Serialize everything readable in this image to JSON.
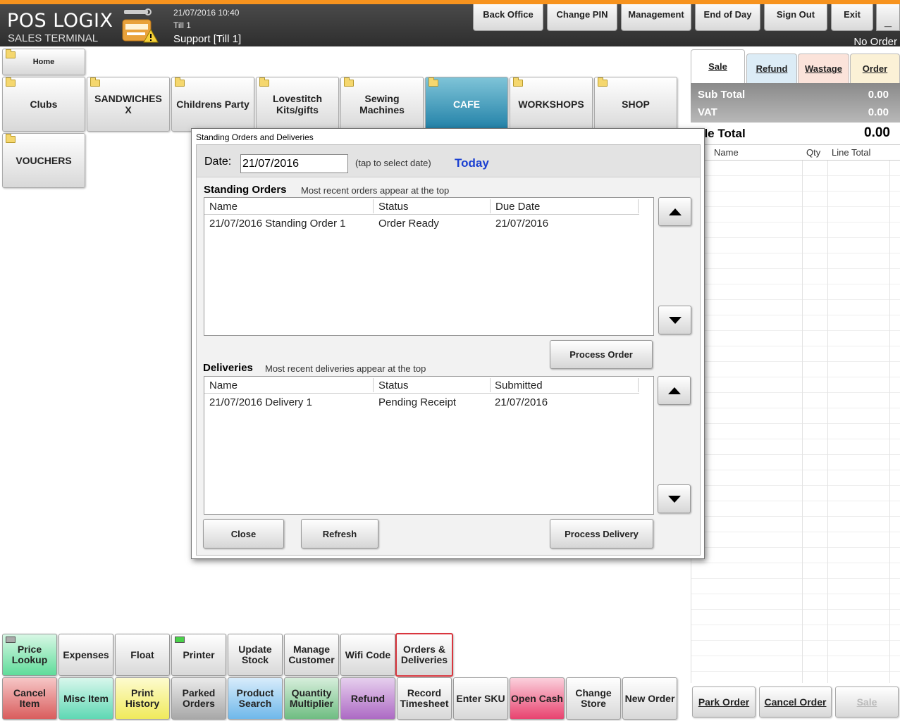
{
  "header": {
    "brand": "POS LOGIX",
    "brand_sub": "SALES TERMINAL",
    "datetime": "21/07/2016 10:40",
    "till": "Till 1",
    "user": "Support [Till 1]",
    "buttons": {
      "back_office": "Back Office",
      "change_pin": "Change PIN",
      "management": "Management",
      "end_of_day": "End of Day",
      "sign_out": "Sign Out",
      "exit": "Exit",
      "minimize": "_"
    },
    "order_status": "No Order",
    "accent_color": "#f7931e"
  },
  "categories": {
    "home": "Home",
    "clubs": "Clubs",
    "sandwiches": "SANDWICHES X",
    "childrens_party": "Childrens Party",
    "lovestitch": "Lovestitch Kits/gifts",
    "sewing": "Sewing Machines",
    "cafe": "CAFE",
    "workshops": "WORKSHOPS",
    "shop": "SHOP",
    "vouchers": "VOUCHERS",
    "selected": "CAFE",
    "selected_color": "#1f7fa6"
  },
  "sale_panel": {
    "tabs": {
      "sale": "Sale",
      "refund": "Refund",
      "wastage": "Wastage",
      "order": "Order"
    },
    "sub_total_label": "Sub Total",
    "sub_total_value": "0.00",
    "vat_label": "VAT",
    "vat_value": "0.00",
    "sale_total_label": "ale Total",
    "sale_total_value": "0.00",
    "columns": {
      "name": "Name",
      "qty": "Qty",
      "line_total": "Line Total"
    },
    "buttons": {
      "park_order": "Park Order",
      "cancel_order": "Cancel Order",
      "sale": "Sale"
    }
  },
  "functions": {
    "price_lookup": "Price Lookup",
    "expenses": "Expenses",
    "float": "Float",
    "printer": "Printer",
    "update_stock": "Update Stock",
    "manage_customer": "Manage Customer",
    "wifi_code": "Wifi Code",
    "orders_deliveries": "Orders & Deliveries",
    "cancel_item": "Cancel Item",
    "misc_item": "Misc Item",
    "print_history": "Print History",
    "parked_orders": "Parked Orders",
    "product_search": "Product Search",
    "quantity_multiplier": "Quantity Multiplier",
    "refund": "Refund",
    "record_timesheet": "Record Timesheet",
    "enter_sku": "Enter SKU",
    "open_cash": "Open Cash",
    "change_store": "Change Store",
    "new_order": "New Order"
  },
  "dialog": {
    "title": "Standing Orders and Deliveries",
    "date_label": "Date:",
    "date_value": "21/07/2016",
    "date_hint": "(tap to select date)",
    "today": "Today",
    "standing": {
      "title": "Standing Orders",
      "subtitle": "Most recent orders appear at the top",
      "columns": [
        "Name",
        "Status",
        "Due Date"
      ],
      "rows": [
        {
          "name": "21/07/2016 Standing Order 1",
          "status": "Order Ready",
          "date": "21/07/2016"
        }
      ],
      "process_button": "Process Order"
    },
    "deliveries": {
      "title": "Deliveries",
      "subtitle": "Most recent deliveries appear at the top",
      "columns": [
        "Name",
        "Status",
        "Submitted"
      ],
      "rows": [
        {
          "name": "21/07/2016 Delivery 1",
          "status": "Pending Receipt",
          "date": "21/07/2016"
        }
      ],
      "process_button": "Process Delivery"
    },
    "close_button": "Close",
    "refresh_button": "Refresh"
  }
}
